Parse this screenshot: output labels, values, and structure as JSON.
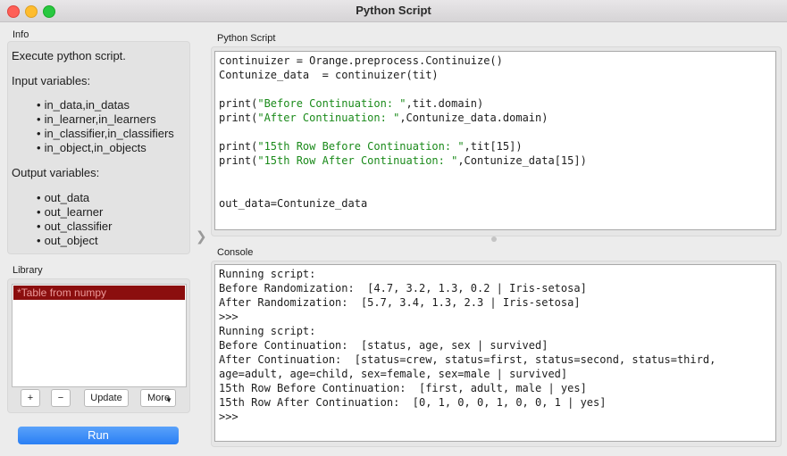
{
  "window": {
    "title": "Python Script"
  },
  "info": {
    "label": "Info",
    "description": "Execute python script.",
    "input_heading": "Input variables:",
    "inputs": [
      "in_data,in_datas",
      "in_learner,in_learners",
      "in_classifier,in_classifiers",
      "in_object,in_objects"
    ],
    "output_heading": "Output variables:",
    "outputs": [
      "out_data",
      "out_learner",
      "out_classifier",
      "out_object"
    ]
  },
  "library": {
    "label": "Library",
    "items": [
      "*Table from numpy"
    ],
    "add_label": "+",
    "remove_label": "−",
    "update_label": "Update",
    "more_label": "More"
  },
  "run_label": "Run",
  "editor": {
    "label": "Python Script",
    "lines": [
      [
        "continuizer = Orange.preprocess.Continuize()"
      ],
      [
        "Contunize_data  = continuizer(tit)"
      ],
      [
        ""
      ],
      [
        "print(",
        "\"Before Continuation: \"",
        ",tit.domain)"
      ],
      [
        "print(",
        "\"After Continuation: \"",
        ",Contunize_data.domain)"
      ],
      [
        ""
      ],
      [
        "print(",
        "\"15th Row Before Continuation: \"",
        ",tit[15])"
      ],
      [
        "print(",
        "\"15th Row After Continuation: \"",
        ",Contunize_data[15])"
      ],
      [
        ""
      ],
      [
        ""
      ],
      [
        "out_data=Contunize_data"
      ]
    ]
  },
  "console": {
    "label": "Console",
    "lines": [
      "Running script:",
      "Before Randomization:  [4.7, 3.2, 1.3, 0.2 | Iris-setosa]",
      "After Randomization:  [5.7, 3.4, 1.3, 2.3 | Iris-setosa]",
      ">>>",
      "Running script:",
      "Before Continuation:  [status, age, sex | survived]",
      "After Continuation:  [status=crew, status=first, status=second, status=third,",
      "age=adult, age=child, sex=female, sex=male | survived]",
      "15th Row Before Continuation:  [first, adult, male | yes]",
      "15th Row After Continuation:  [0, 1, 0, 0, 1, 0, 0, 1 | yes]",
      ">>>"
    ]
  },
  "colors": {
    "run_button": "#2a7ff4",
    "selected_item": "#8b0e0e",
    "string_literal": "#1a8a1a"
  }
}
